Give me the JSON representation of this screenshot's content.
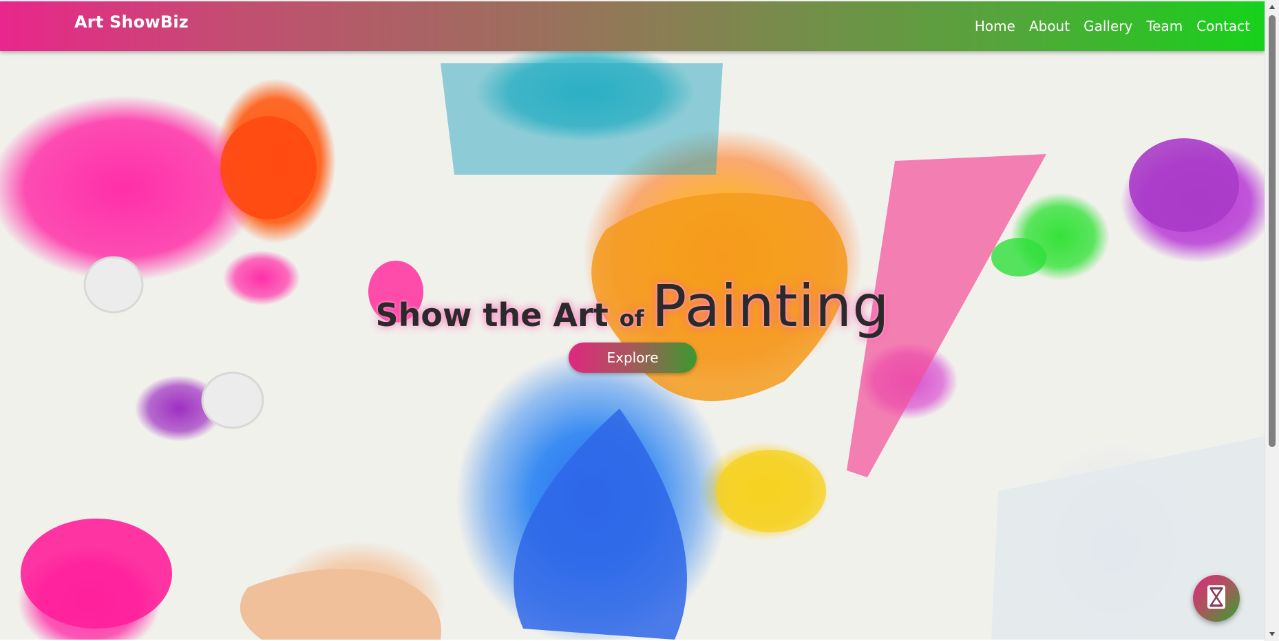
{
  "header": {
    "brand": "Art ShowBiz",
    "nav": [
      {
        "label": "Home"
      },
      {
        "label": "About"
      },
      {
        "label": "Gallery"
      },
      {
        "label": "Team"
      },
      {
        "label": "Contact"
      }
    ]
  },
  "hero": {
    "title_part1": "Show the Art ",
    "title_part2": "of ",
    "title_part3": "Painting",
    "button_label": "Explore"
  },
  "widget": {
    "icon": "hourglass-icon"
  },
  "colors": {
    "nav_gradient_start": "#e9268b",
    "nav_gradient_end": "#16d21a",
    "button_gradient_start": "#e0277f",
    "button_gradient_end": "#3b9a2e"
  }
}
